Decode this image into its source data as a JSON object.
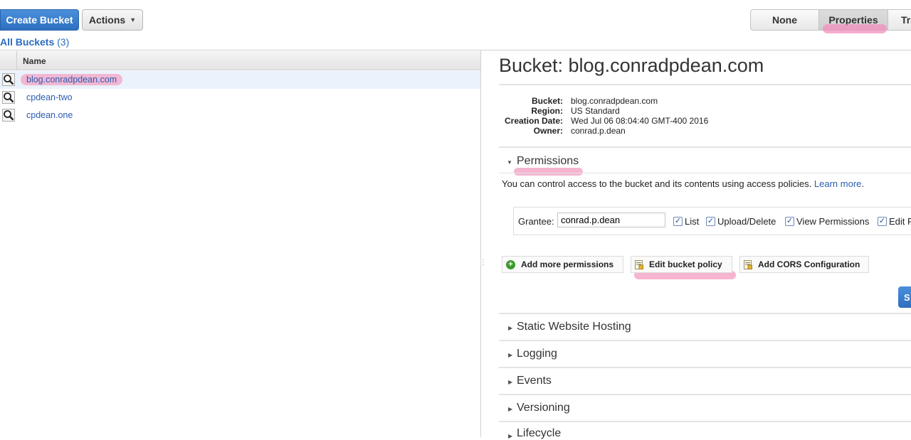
{
  "toolbar": {
    "create_bucket": "Create Bucket",
    "actions": "Actions",
    "view_none": "None",
    "view_properties": "Properties",
    "view_transfers": "Tra"
  },
  "buckets_header": {
    "label": "All Buckets",
    "count": "(3)"
  },
  "grid": {
    "column_name": "Name",
    "rows": [
      "blog.conradpdean.com",
      "cpdean-two",
      "cpdean.one"
    ]
  },
  "detail": {
    "title": "Bucket: blog.conradpdean.com",
    "info": [
      {
        "label": "Bucket:",
        "value": "blog.conradpdean.com"
      },
      {
        "label": "Region:",
        "value": "US Standard"
      },
      {
        "label": "Creation Date:",
        "value": "Wed Jul 06 08:04:40 GMT-400 2016"
      },
      {
        "label": "Owner:",
        "value": "conrad.p.dean"
      }
    ],
    "permissions": {
      "heading": "Permissions",
      "description": "You can control access to the bucket and its contents using access policies.",
      "learn_more": "Learn more",
      "period": ".",
      "grantee_label": "Grantee:",
      "grantee_value": "conrad.p.dean",
      "checkboxes": [
        "List",
        "Upload/Delete",
        "View Permissions",
        "Edit P"
      ],
      "add_more": "Add more permissions",
      "edit_policy": "Edit bucket policy",
      "add_cors": "Add CORS Configuration",
      "save": "S"
    },
    "sections": [
      "Static Website Hosting",
      "Logging",
      "Events",
      "Versioning",
      "Lifecycle"
    ]
  }
}
